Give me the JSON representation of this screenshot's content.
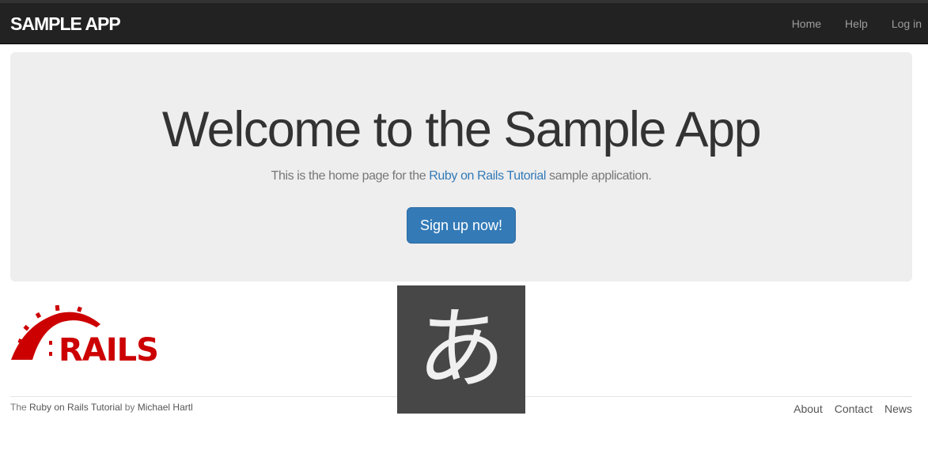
{
  "navbar": {
    "brand": "SAMPLE APP",
    "links": [
      "Home",
      "Help",
      "Log in"
    ]
  },
  "jumbotron": {
    "title": "Welcome to the Sample App",
    "subtitle_before": "This is the home page for the ",
    "subtitle_link": "Ruby on Rails Tutorial",
    "subtitle_after": " sample application.",
    "button_label": "Sign up now!"
  },
  "logo": {
    "text": "RAILS",
    "color": "#cc0000",
    "icon": "rails-logo"
  },
  "ime_indicator": {
    "glyph": "あ"
  },
  "footer": {
    "prefix": "The ",
    "tutorial_link": "Ruby on Rails Tutorial",
    "by": " by ",
    "author_link": "Michael Hartl",
    "links": [
      "About",
      "Contact",
      "News"
    ]
  },
  "colors": {
    "navbar_bg": "#222222",
    "jumbotron_bg": "#eeeeee",
    "primary": "#337ab7",
    "link": "#337ab7"
  }
}
